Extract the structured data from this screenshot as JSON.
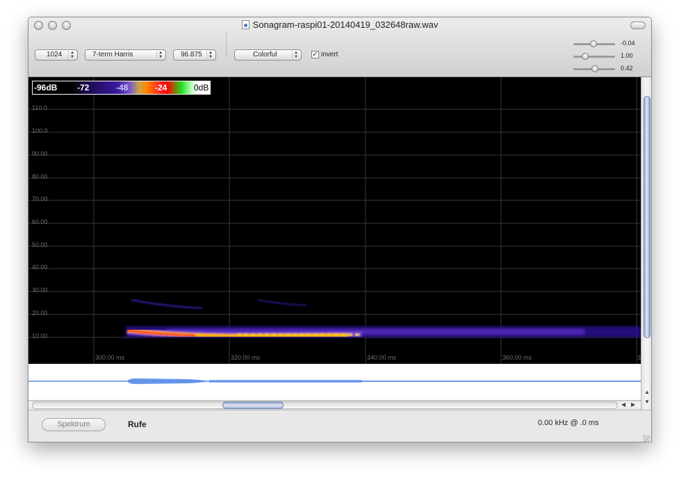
{
  "window": {
    "title": "Sonagram-raspi01-20140419_032648raw.wav"
  },
  "toolbar": {
    "fft_size": "1024",
    "window_function": "7-term Harris",
    "overlap": "96.875",
    "palette": "Colorful",
    "invert_label": "invert",
    "invert_checked": true,
    "sliders": [
      {
        "value_label": "-0.04",
        "position": 0.47
      },
      {
        "value_label": "1.00",
        "position": 0.24
      },
      {
        "value_label": "0.42",
        "position": 0.52
      }
    ]
  },
  "legend": {
    "labels": [
      "-96dB",
      "-72",
      "-48",
      "-24",
      "0dB"
    ]
  },
  "spectrogram": {
    "y_axis_labels": [
      "110.0",
      "100.0",
      "90.00",
      "80.00",
      "70.00",
      "60.00",
      "50.00",
      "40.00",
      "30.00",
      "20.00",
      "10.00"
    ],
    "x_axis_labels": [
      "300.00 ms",
      "320.00 ms",
      "340.00 ms",
      "360.00 ms",
      "3"
    ]
  },
  "scrollbars": {
    "vertical_position": 0.25,
    "horizontal_position": 0.36
  },
  "bottom": {
    "spektrum_button": "Spektrum",
    "rufe_label": "Rufe",
    "status": "0.00 kHz  @  .0 ms"
  },
  "colors": {
    "background": "#000000",
    "grid": "#3a3a3a",
    "waveform": "#5a8ee8",
    "call_core": "#ff2a2a",
    "call_mid": "#ffb000",
    "call_outer": "#3a1ab0"
  }
}
